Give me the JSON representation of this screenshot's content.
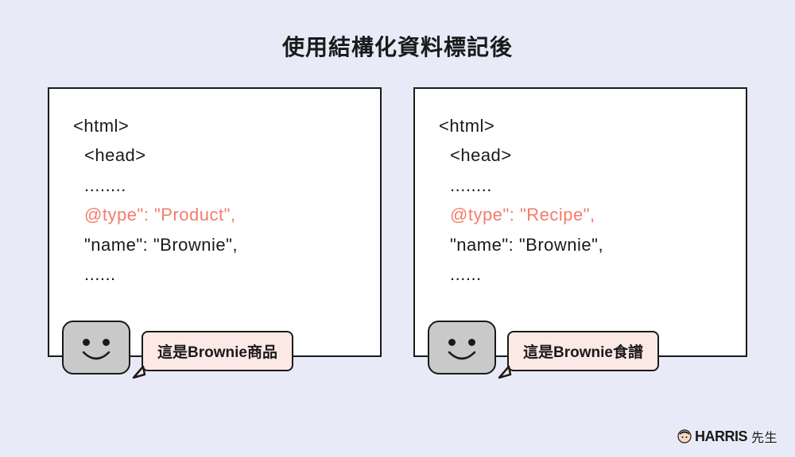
{
  "title": "使用結構化資料標記後",
  "boxes": [
    {
      "lines": {
        "l1": "<html>",
        "l2": "<head>",
        "l3": "........",
        "l4": "@type\": \"Product\",",
        "l5": "\"name\": \"Brownie\",",
        "l6": "......"
      },
      "speech": "這是Brownie商品"
    },
    {
      "lines": {
        "l1": "<html>",
        "l2": "<head>",
        "l3": "........",
        "l4": "@type\": \"Recipe\",",
        "l5": "\"name\": \"Brownie\",",
        "l6": "......"
      },
      "speech": "這是Brownie食譜"
    }
  ],
  "brand": {
    "name": "HARRIS",
    "suffix": "先生"
  }
}
